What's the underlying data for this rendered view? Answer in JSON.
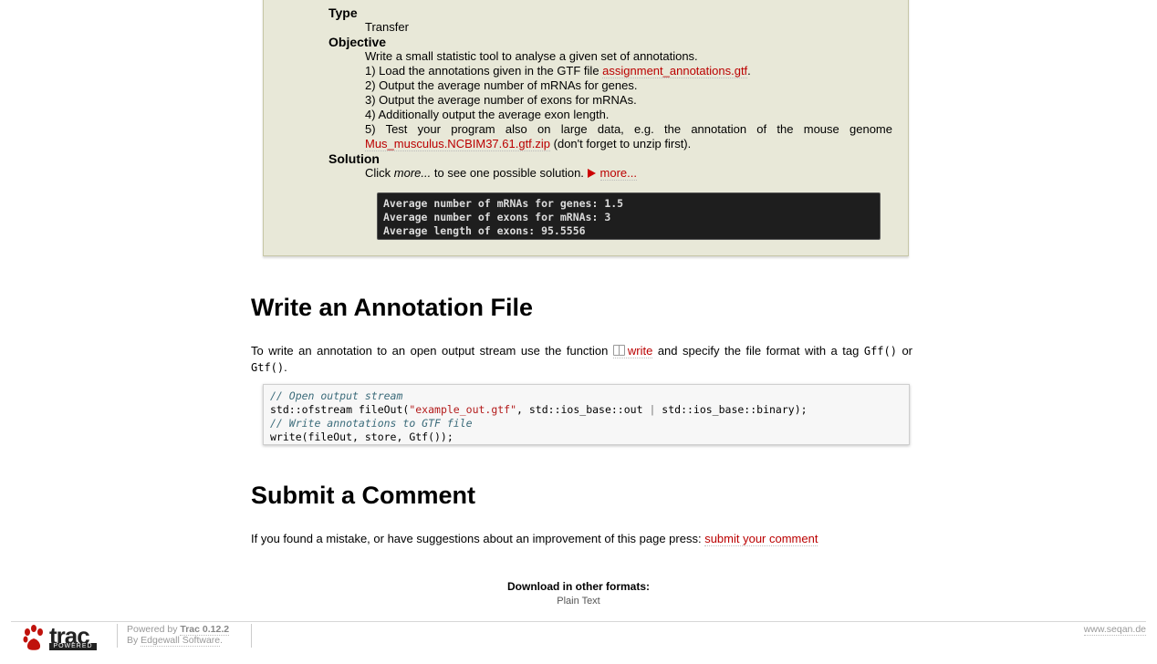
{
  "assignment": {
    "type_label": "Type",
    "type_value": "Transfer",
    "objective_label": "Objective",
    "objective_lines": {
      "intro": "Write a small statistic tool to analyse a given set of annotations.",
      "l1_prefix": "1) Load the annotations given in the GTF file ",
      "l1_link": "assignment_annotations.gtf",
      "l1_suffix": ".",
      "l2": "2) Output the average number of mRNAs for genes.",
      "l3": "3) Output the average number of exons for mRNAs.",
      "l4": "4) Additionally output the average exon length.",
      "l5": "5) Test your program also on large data, e.g. the annotation of the mouse genome",
      "l6_link": "Mus_musculus.NCBIM37.61.gtf.zip",
      "l6_suffix": " (don't forget to unzip first)."
    },
    "solution_label": "Solution",
    "solution_prefix": "Click ",
    "solution_em": "more...",
    "solution_suffix": " to see one possible solution.",
    "more_link": "more...",
    "console_output": "Average number of mRNAs for genes: 1.5\nAverage number of exons for mRNAs: 3\nAverage length of exons: 95.5556"
  },
  "write_section": {
    "heading": "Write an Annotation File",
    "text_prefix": "To write an annotation to an open output stream use the function ",
    "func_link": "write",
    "text_middle": " and specify the file format with a tag ",
    "tag1": "Gff()",
    "text_or": " or ",
    "tag2": "Gtf()",
    "text_end": ".",
    "code": {
      "c1": "// Open output stream",
      "l2_a": "std::ofstream fileOut(",
      "l2_str": "\"example_out.gtf\"",
      "l2_b": ", std::ios_base::out ",
      "l2_op": "|",
      "l2_c": " std::ios_base::binary);",
      "c3": "// Write annotations to GTF file",
      "l4": "write(fileOut, store, Gtf());"
    }
  },
  "comment_section": {
    "heading": "Submit a Comment",
    "text": "If you found a mistake, or have suggestions about an improvement of this page press: ",
    "link": "submit your comment"
  },
  "download": {
    "title": "Download in other formats:",
    "plain_text": "Plain Text"
  },
  "footer": {
    "logo_text": "trac",
    "logo_bar": "POWERED",
    "powered_by": "Powered by ",
    "trac_version": "Trac 0.12.2",
    "by_prefix": "By ",
    "edgewall": "Edgewall Software",
    "by_suffix": ".",
    "site": "www.seqan.de"
  },
  "colors": {
    "link": "#bb0000",
    "assignment_bg": "#e8e8d8",
    "console_bg": "#1e1e1e"
  }
}
